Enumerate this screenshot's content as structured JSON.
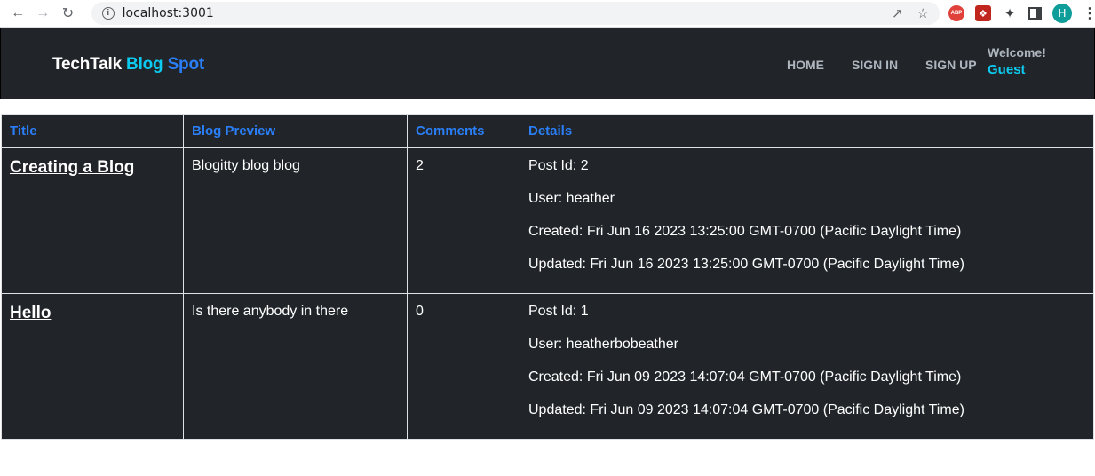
{
  "browser": {
    "url": "localhost:3001",
    "profile_initial": "H",
    "abp_label": "ABP"
  },
  "header": {
    "brand_part1": "TechTalk",
    "brand_part2": "Blog",
    "brand_part3": "Spot",
    "nav": {
      "home": "HOME",
      "sign_in": "SIGN IN",
      "sign_up": "SIGN UP"
    },
    "welcome_label": "Welcome!",
    "user_name": "Guest"
  },
  "table": {
    "columns": [
      "Title",
      "Blog Preview",
      "Comments",
      "Details"
    ],
    "rows": [
      {
        "title": "Creating a Blog",
        "preview": "Blogitty blog blog",
        "comments": "2",
        "post_id": "Post Id: 2",
        "user": "User: heather",
        "created": "Created: Fri Jun 16 2023 13:25:00 GMT-0700 (Pacific Daylight Time)",
        "updated": "Updated: Fri Jun 16 2023 13:25:00 GMT-0700 (Pacific Daylight Time)"
      },
      {
        "title": "Hello",
        "preview": "Is there anybody in there",
        "comments": "0",
        "post_id": "Post Id: 1",
        "user": "User: heatherbobeather",
        "created": "Created: Fri Jun 09 2023 14:07:04 GMT-0700 (Pacific Daylight Time)",
        "updated": "Updated: Fri Jun 09 2023 14:07:04 GMT-0700 (Pacific Daylight Time)"
      }
    ]
  },
  "colors": {
    "header_bg": "#212529",
    "accent_cyan": "#0dcaf0",
    "accent_blue": "#2a7ef7",
    "nav_gray": "#adb5bd"
  }
}
